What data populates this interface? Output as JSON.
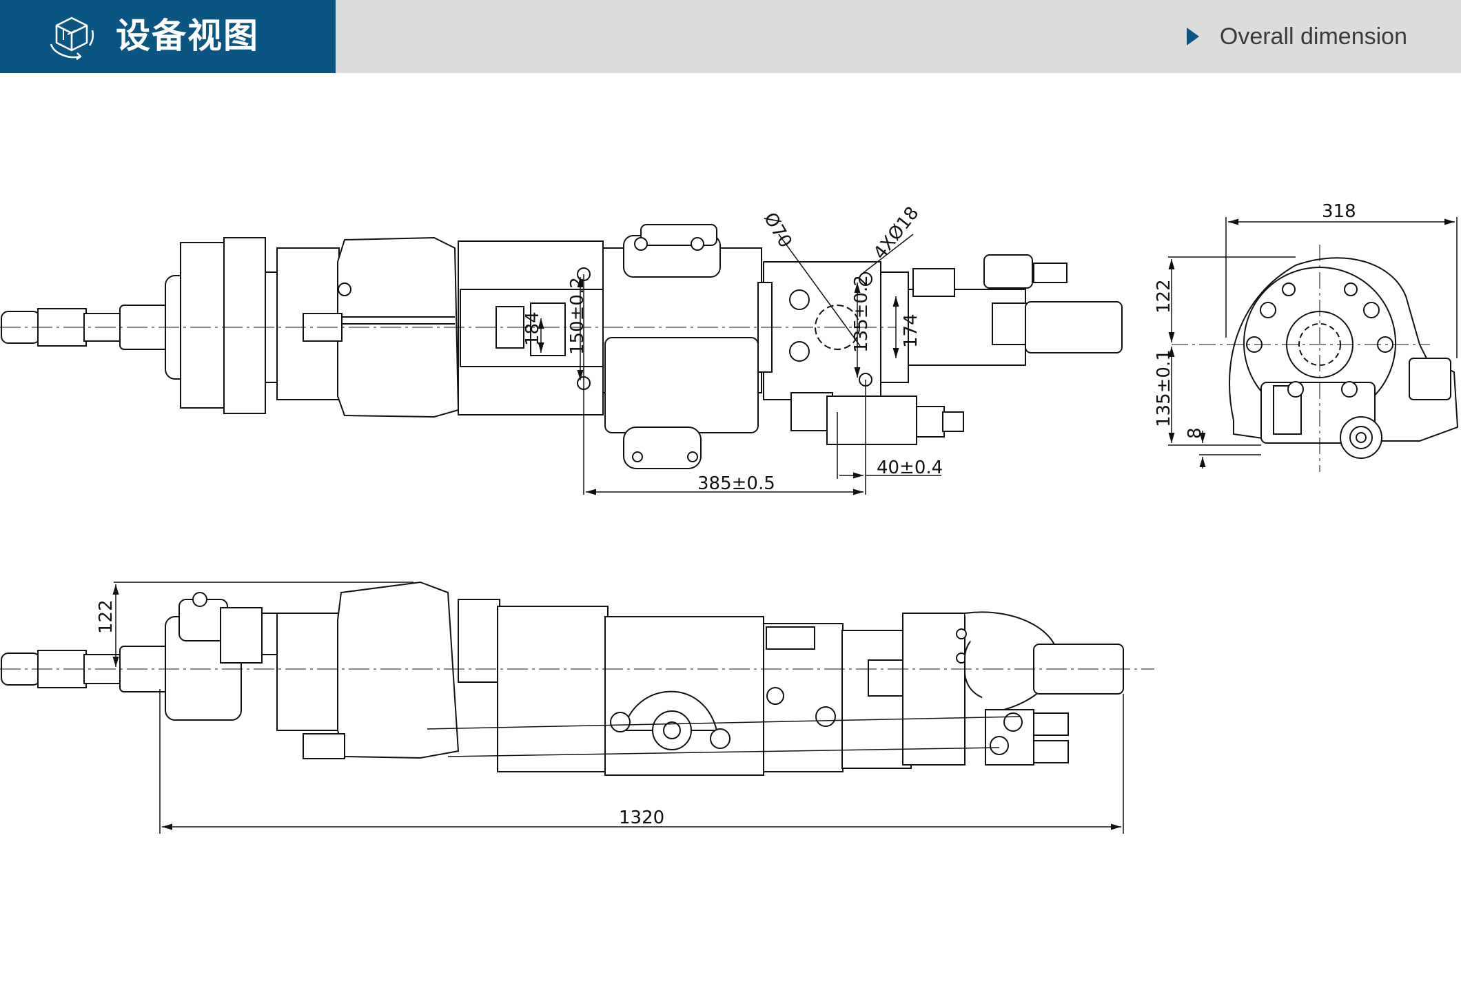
{
  "header": {
    "title": "设备视图",
    "nav_label": "Overall dimension",
    "title_bg": "#0b5582",
    "bar_bg": "#dcdcdc"
  },
  "icons": {
    "title": "3d-cube-rotate-icon",
    "nav": "triangle-right-icon"
  },
  "dimensions": {
    "top_dia": "Ø70",
    "top_holes": "4XØ18",
    "top_v150": "150±0.2",
    "top_v184": "184",
    "top_v135": "135±0.2",
    "top_v174": "174",
    "top_h385": "385±0.5",
    "top_h40": "40±0.4",
    "end_w318": "318",
    "end_v122": "122",
    "end_v135": "135±0.1",
    "end_v8": "8",
    "side_v122": "122",
    "side_h1320": "1320"
  }
}
